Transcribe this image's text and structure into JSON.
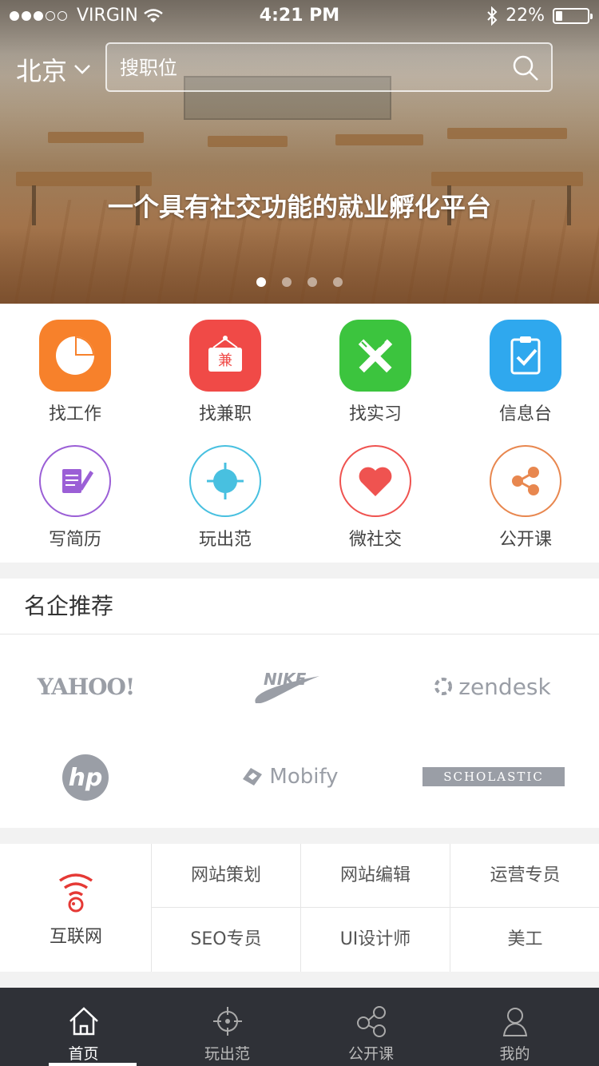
{
  "status_bar": {
    "carrier": "VIRGIN",
    "time": "4:21 PM",
    "battery": "22%",
    "battery_level": 0.22
  },
  "header": {
    "city": "北京",
    "search_placeholder": "搜职位"
  },
  "banner": {
    "slogan": "一个具有社交功能的就业孵化平台",
    "page_count": 4,
    "active_page": 1
  },
  "grid": [
    {
      "label": "找工作",
      "icon": "pie-chart-icon",
      "color": "#f7812b"
    },
    {
      "label": "找兼职",
      "icon": "part-time-sign-icon",
      "color": "#f04a47",
      "icon_text": "兼"
    },
    {
      "label": "找实习",
      "icon": "ruler-pencil-icon",
      "color": "#3cc43e"
    },
    {
      "label": "信息台",
      "icon": "clipboard-check-icon",
      "color": "#2fa8ee"
    },
    {
      "label": "写简历",
      "icon": "resume-edit-icon",
      "color": "#9b5fd6"
    },
    {
      "label": "玩出范",
      "icon": "target-icon",
      "color": "#48c0e0"
    },
    {
      "label": "微社交",
      "icon": "heart-icon",
      "color": "#ef5350"
    },
    {
      "label": "公开课",
      "icon": "share-nodes-icon",
      "color": "#e8874f"
    }
  ],
  "companies": {
    "title": "名企推荐",
    "logos": [
      "YAHOO!",
      "NIKE",
      "zendesk",
      "hp",
      "Mobify",
      "SCHOLASTIC"
    ]
  },
  "jobs": {
    "category": "互联网",
    "items": [
      "网站策划",
      "网站编辑",
      "运营专员",
      "SEO专员",
      "UI设计师",
      "美工"
    ]
  },
  "tabbar": [
    {
      "label": "首页",
      "icon": "home-icon",
      "active": true
    },
    {
      "label": "玩出范",
      "icon": "target-icon",
      "active": false
    },
    {
      "label": "公开课",
      "icon": "share-nodes-icon",
      "active": false
    },
    {
      "label": "我的",
      "icon": "user-icon",
      "active": false
    }
  ]
}
